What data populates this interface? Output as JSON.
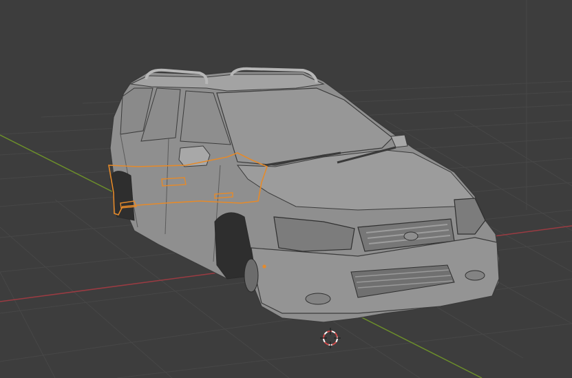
{
  "app": {
    "name": "3D Viewport"
  },
  "colors": {
    "background": "#3d3d3d",
    "grid": "#4a4a4a",
    "x_axis": "#9b3b42",
    "y_axis": "#6c8f2a",
    "selection": "#e58a2a",
    "model_body": "#9a9a9a",
    "model_shadow": "#6f6f6f",
    "cursor_red": "#d04a4a"
  },
  "scene": {
    "object": "car-body-mesh",
    "selected_part": "door-panel",
    "tools": [
      "3d-cursor-icon"
    ]
  }
}
